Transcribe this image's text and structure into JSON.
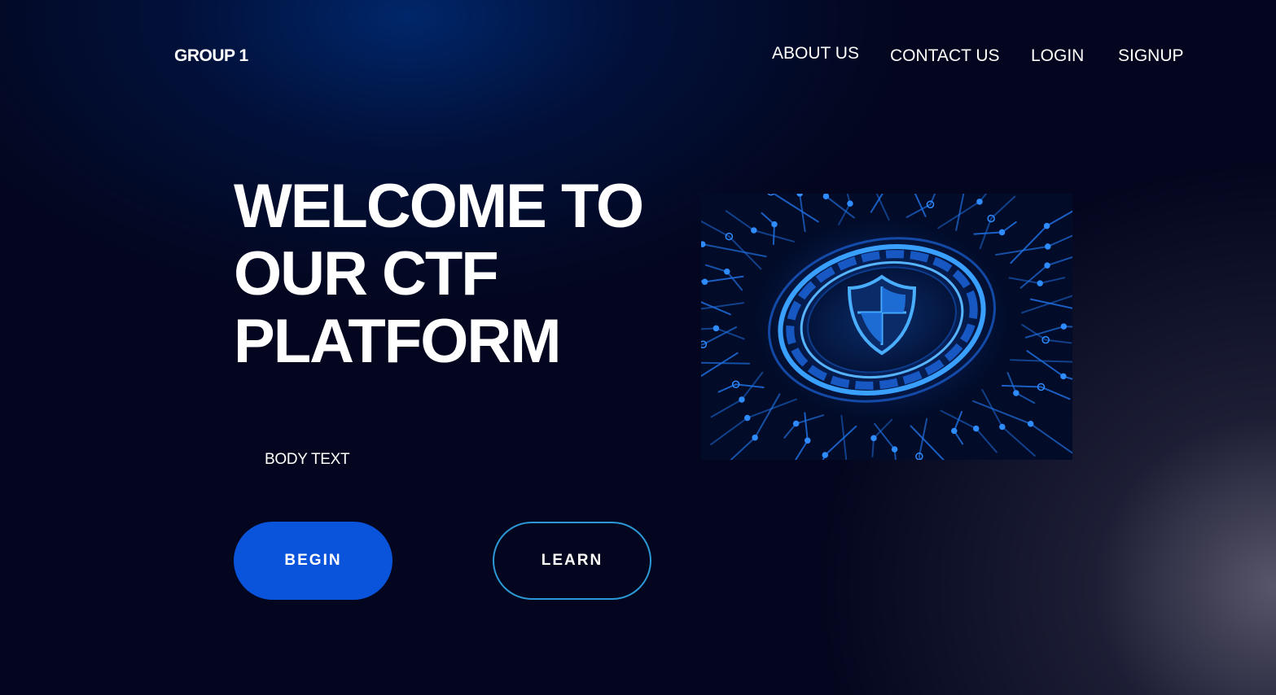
{
  "header": {
    "brand": "GROUP 1",
    "nav": [
      {
        "label": "ABOUT US"
      },
      {
        "label": "CONTACT US"
      },
      {
        "label": "LOGIN"
      },
      {
        "label": "SIGNUP"
      }
    ]
  },
  "hero": {
    "title_lines": [
      "WELCOME TO",
      "OUR CTF",
      "PLATFORM"
    ],
    "body_text": "BODY TEXT",
    "begin_label": "BEGIN",
    "learn_label": "LEARN",
    "image_icon": "shield-circuit-icon"
  },
  "colors": {
    "background": "#03061e",
    "primary_button": "#0a54db",
    "outline_button": "#2c98d6",
    "text": "#ffffff"
  }
}
